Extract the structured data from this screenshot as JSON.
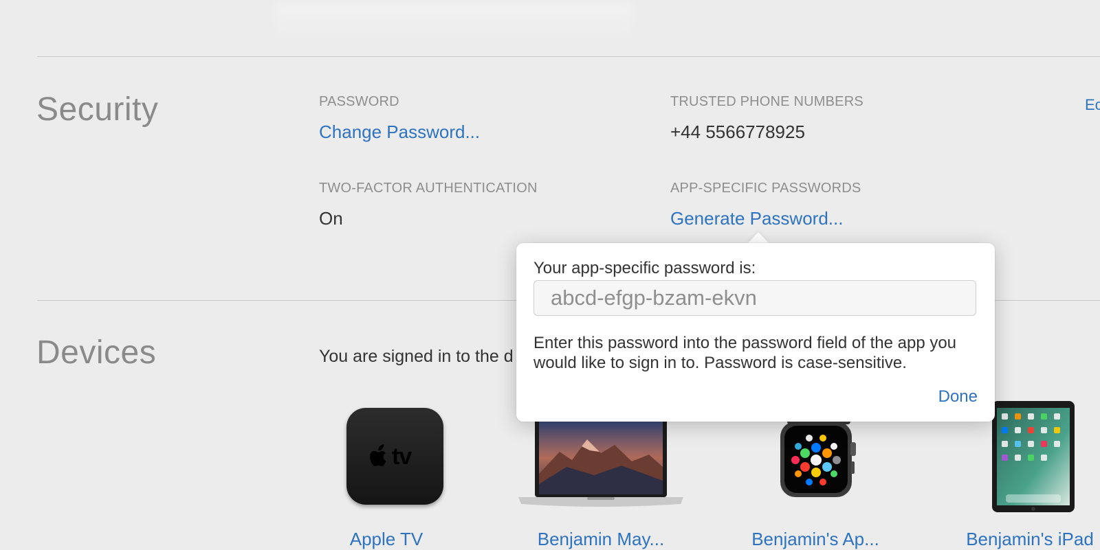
{
  "security": {
    "title": "Security",
    "edit_label": "Ec",
    "password": {
      "label": "PASSWORD",
      "link": "Change Password..."
    },
    "trusted_phone": {
      "label": "TRUSTED PHONE NUMBERS",
      "value": "+44 5566778925"
    },
    "two_factor": {
      "label": "TWO-FACTOR AUTHENTICATION",
      "value": "On"
    },
    "app_specific": {
      "label": "APP-SPECIFIC PASSWORDS",
      "link": "Generate Password..."
    }
  },
  "popover": {
    "label": "Your app-specific password is:",
    "password_value": "abcd-efgp-bzam-ekvn",
    "description": "Enter this password into the password field of the app you would like to sign in to. Password is case-sensitive.",
    "done_label": "Done"
  },
  "devices": {
    "title": "Devices",
    "intro": "You are signed in to the d",
    "items": [
      {
        "name": "Apple TV",
        "icon": "apple-tv-icon"
      },
      {
        "name": "Benjamin May...",
        "icon": "macbook-icon"
      },
      {
        "name": "Benjamin's Ap...",
        "icon": "apple-watch-icon"
      },
      {
        "name": "Benjamin's iPad",
        "icon": "ipad-icon"
      }
    ]
  },
  "colors": {
    "background": "#ececec",
    "link": "#2e73c1",
    "label": "#8e8e8e",
    "section_title": "#8a8a8a"
  }
}
